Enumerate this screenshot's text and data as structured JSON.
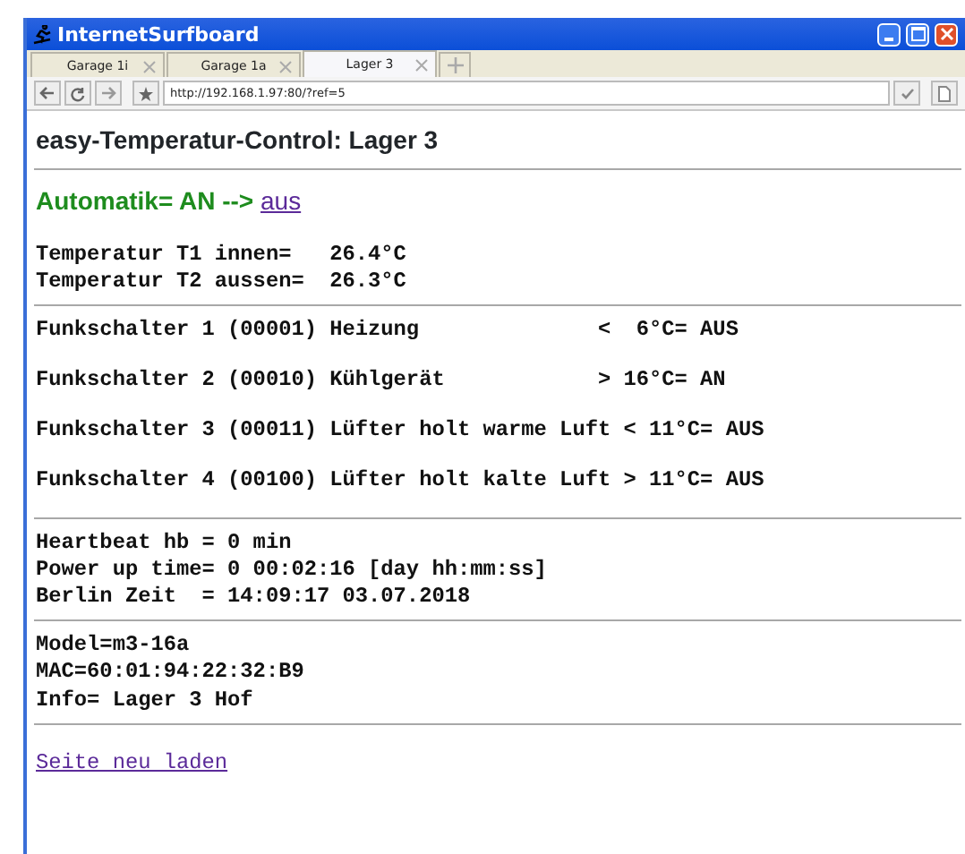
{
  "window": {
    "title": "InternetSurfboard"
  },
  "tabs": [
    {
      "label": "Garage 1i",
      "selected": false
    },
    {
      "label": "Garage 1a",
      "selected": false
    },
    {
      "label": "Lager 3",
      "selected": true
    }
  ],
  "address_bar": {
    "url": "http://192.168.1.97:80/?ref=5"
  },
  "page": {
    "heading": "easy-Temperatur-Control: Lager 3",
    "automatik": {
      "label": "Automatik= AN -->",
      "link": "aus"
    },
    "sections": [
      {
        "lines": [
          "Temperatur T1 innen=   26.4°C",
          "Temperatur T2 aussen=  26.3°C"
        ],
        "spaced": false
      },
      {
        "lines": [
          "Funkschalter 1 (00001) Heizung              <  6°C= AUS",
          "Funkschalter 2 (00010) Kühlgerät            > 16°C= AN",
          "Funkschalter 3 (00011) Lüfter holt warme Luft < 11°C= AUS",
          "Funkschalter 4 (00100) Lüfter holt kalte Luft > 11°C= AUS"
        ],
        "spaced": true
      },
      {
        "lines": [
          "Heartbeat hb = 0 min",
          "Power up time= 0 00:02:16 [day hh:mm:ss]",
          "Berlin Zeit  = 14:09:17 03.07.2018"
        ],
        "spaced": false
      },
      {
        "lines": [
          "Model=m3-16a",
          "MAC=60:01:94:22:32:B9",
          "Info= Lager 3 Hof"
        ],
        "spaced": false
      }
    ],
    "reload_link": "Seite neu laden"
  }
}
